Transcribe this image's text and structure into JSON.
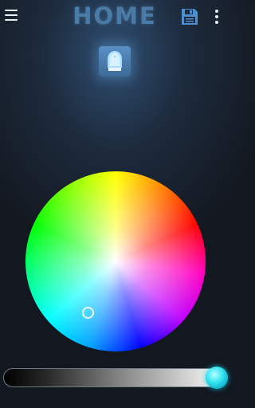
{
  "header": {
    "title": "HOME",
    "menu_icon": "hamburger-menu-icon",
    "save_icon": "floppy-disk-icon",
    "more_icon": "vertical-ellipsis-icon"
  },
  "device": {
    "icon": "light-bulb-icon",
    "accent": "#5a8fc4"
  },
  "color_wheel": {
    "selected_color": "#7fbfff"
  },
  "brightness": {
    "level_percent": 100,
    "thumb_color": "#38e6f2"
  }
}
